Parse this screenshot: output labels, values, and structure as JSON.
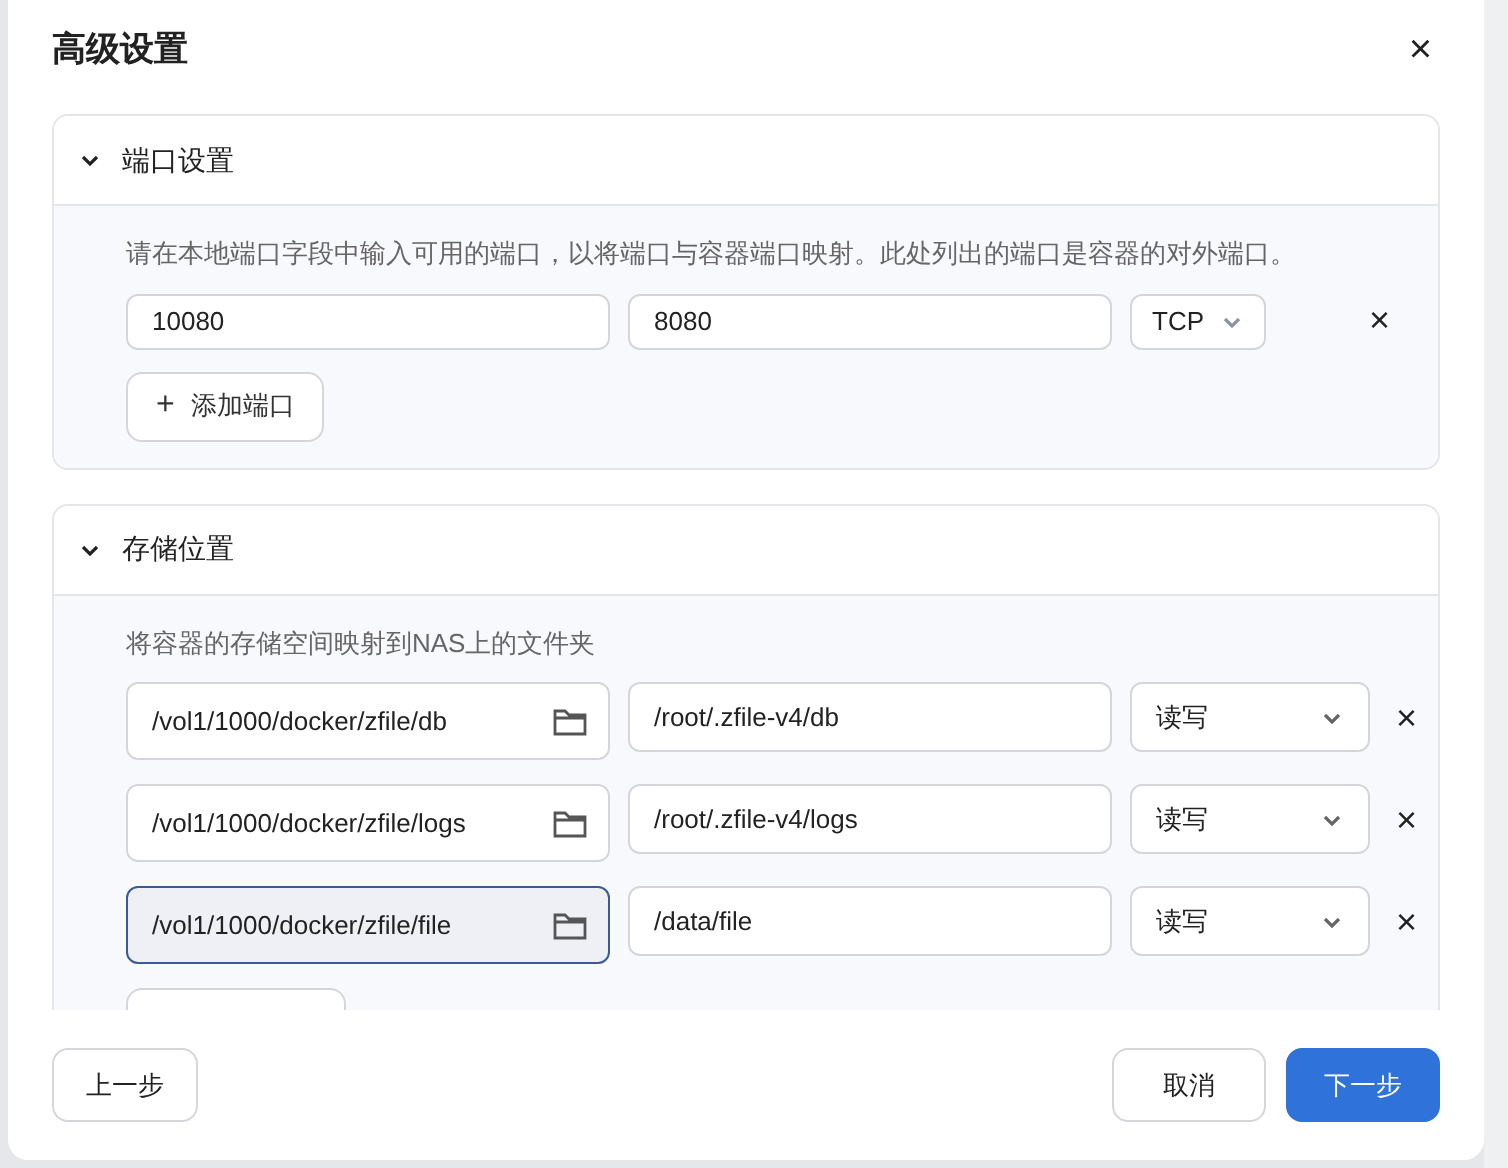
{
  "dialog": {
    "title": "高级设置",
    "close": "×"
  },
  "sections": [
    {
      "kind": "ports",
      "title": "端口设置",
      "expanded": true,
      "description": "请在本地端口字段中输入可用的端口，以将端口与容器端口映射。此处列出的端口是容器的对外端口。",
      "rows": [
        {
          "local": "10080",
          "container": "8080",
          "protocol": "TCP",
          "remove": "×"
        }
      ],
      "add_icon": "+",
      "add_label": "添加端口"
    },
    {
      "kind": "storage",
      "title": "存储位置",
      "expanded": true,
      "description": "将容器的存储空间映射到NAS上的文件夹",
      "rows": [
        {
          "host": "/vol1/1000/docker/zfile/db",
          "container": "/root/.zfile-v4/db",
          "mode": "读写",
          "focused": false,
          "remove": "×"
        },
        {
          "host": "/vol1/1000/docker/zfile/logs",
          "container": "/root/.zfile-v4/logs",
          "mode": "读写",
          "focused": false,
          "remove": "×"
        },
        {
          "host": "/vol1/1000/docker/zfile/file",
          "container": "/data/file",
          "mode": "读写",
          "focused": true,
          "remove": "×"
        }
      ]
    }
  ],
  "footer": {
    "back": "上一步",
    "cancel": "取消",
    "next": "下一步"
  }
}
